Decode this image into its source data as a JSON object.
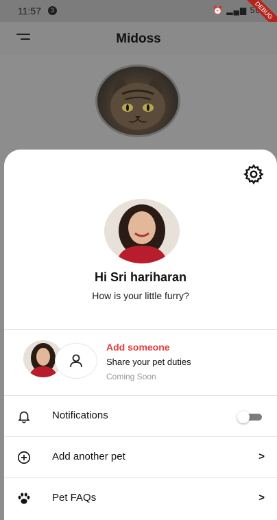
{
  "status_bar": {
    "time": "11:57",
    "notification_count": "3",
    "right_indicators": "56",
    "debug_label": "DEBUG"
  },
  "app_bar": {
    "title": "Midoss"
  },
  "profile": {
    "greeting": "Hi Sri hariharan",
    "subtitle": "How is your little furry?"
  },
  "add_someone": {
    "title": "Add someone",
    "subtitle": "Share your pet duties",
    "status": "Coming Soon"
  },
  "settings_rows": [
    {
      "label": "Notifications",
      "icon": "bell-icon",
      "control": "toggle",
      "toggle_on": false
    },
    {
      "label": "Add another pet",
      "icon": "plus-circle-icon",
      "control": "chevron"
    },
    {
      "label": "Pet FAQs",
      "icon": "paw-icon",
      "control": "chevron"
    }
  ],
  "chevron_glyph": ">",
  "colors": {
    "accent_red": "#e43b3b",
    "sheet_bg": "#ffffff",
    "overlay_gray": "#8d8d8d"
  }
}
